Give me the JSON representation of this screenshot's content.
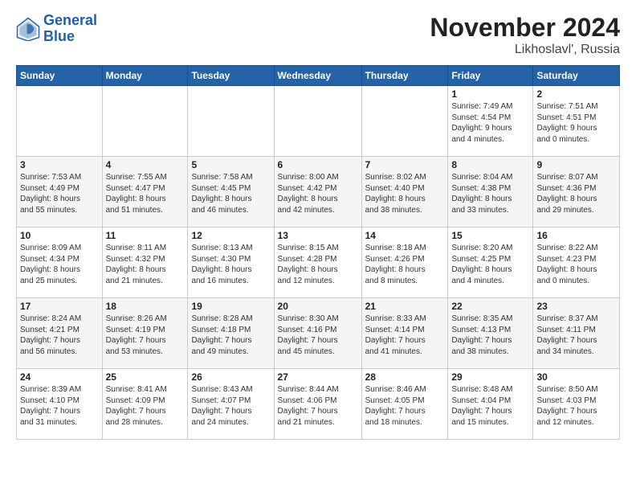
{
  "header": {
    "logo_line1": "General",
    "logo_line2": "Blue",
    "month": "November 2024",
    "location": "Likhoslavl', Russia"
  },
  "weekdays": [
    "Sunday",
    "Monday",
    "Tuesday",
    "Wednesday",
    "Thursday",
    "Friday",
    "Saturday"
  ],
  "rows": [
    [
      {
        "day": "",
        "info": ""
      },
      {
        "day": "",
        "info": ""
      },
      {
        "day": "",
        "info": ""
      },
      {
        "day": "",
        "info": ""
      },
      {
        "day": "",
        "info": ""
      },
      {
        "day": "1",
        "info": "Sunrise: 7:49 AM\nSunset: 4:54 PM\nDaylight: 9 hours\nand 4 minutes."
      },
      {
        "day": "2",
        "info": "Sunrise: 7:51 AM\nSunset: 4:51 PM\nDaylight: 9 hours\nand 0 minutes."
      }
    ],
    [
      {
        "day": "3",
        "info": "Sunrise: 7:53 AM\nSunset: 4:49 PM\nDaylight: 8 hours\nand 55 minutes."
      },
      {
        "day": "4",
        "info": "Sunrise: 7:55 AM\nSunset: 4:47 PM\nDaylight: 8 hours\nand 51 minutes."
      },
      {
        "day": "5",
        "info": "Sunrise: 7:58 AM\nSunset: 4:45 PM\nDaylight: 8 hours\nand 46 minutes."
      },
      {
        "day": "6",
        "info": "Sunrise: 8:00 AM\nSunset: 4:42 PM\nDaylight: 8 hours\nand 42 minutes."
      },
      {
        "day": "7",
        "info": "Sunrise: 8:02 AM\nSunset: 4:40 PM\nDaylight: 8 hours\nand 38 minutes."
      },
      {
        "day": "8",
        "info": "Sunrise: 8:04 AM\nSunset: 4:38 PM\nDaylight: 8 hours\nand 33 minutes."
      },
      {
        "day": "9",
        "info": "Sunrise: 8:07 AM\nSunset: 4:36 PM\nDaylight: 8 hours\nand 29 minutes."
      }
    ],
    [
      {
        "day": "10",
        "info": "Sunrise: 8:09 AM\nSunset: 4:34 PM\nDaylight: 8 hours\nand 25 minutes."
      },
      {
        "day": "11",
        "info": "Sunrise: 8:11 AM\nSunset: 4:32 PM\nDaylight: 8 hours\nand 21 minutes."
      },
      {
        "day": "12",
        "info": "Sunrise: 8:13 AM\nSunset: 4:30 PM\nDaylight: 8 hours\nand 16 minutes."
      },
      {
        "day": "13",
        "info": "Sunrise: 8:15 AM\nSunset: 4:28 PM\nDaylight: 8 hours\nand 12 minutes."
      },
      {
        "day": "14",
        "info": "Sunrise: 8:18 AM\nSunset: 4:26 PM\nDaylight: 8 hours\nand 8 minutes."
      },
      {
        "day": "15",
        "info": "Sunrise: 8:20 AM\nSunset: 4:25 PM\nDaylight: 8 hours\nand 4 minutes."
      },
      {
        "day": "16",
        "info": "Sunrise: 8:22 AM\nSunset: 4:23 PM\nDaylight: 8 hours\nand 0 minutes."
      }
    ],
    [
      {
        "day": "17",
        "info": "Sunrise: 8:24 AM\nSunset: 4:21 PM\nDaylight: 7 hours\nand 56 minutes."
      },
      {
        "day": "18",
        "info": "Sunrise: 8:26 AM\nSunset: 4:19 PM\nDaylight: 7 hours\nand 53 minutes."
      },
      {
        "day": "19",
        "info": "Sunrise: 8:28 AM\nSunset: 4:18 PM\nDaylight: 7 hours\nand 49 minutes."
      },
      {
        "day": "20",
        "info": "Sunrise: 8:30 AM\nSunset: 4:16 PM\nDaylight: 7 hours\nand 45 minutes."
      },
      {
        "day": "21",
        "info": "Sunrise: 8:33 AM\nSunset: 4:14 PM\nDaylight: 7 hours\nand 41 minutes."
      },
      {
        "day": "22",
        "info": "Sunrise: 8:35 AM\nSunset: 4:13 PM\nDaylight: 7 hours\nand 38 minutes."
      },
      {
        "day": "23",
        "info": "Sunrise: 8:37 AM\nSunset: 4:11 PM\nDaylight: 7 hours\nand 34 minutes."
      }
    ],
    [
      {
        "day": "24",
        "info": "Sunrise: 8:39 AM\nSunset: 4:10 PM\nDaylight: 7 hours\nand 31 minutes."
      },
      {
        "day": "25",
        "info": "Sunrise: 8:41 AM\nSunset: 4:09 PM\nDaylight: 7 hours\nand 28 minutes."
      },
      {
        "day": "26",
        "info": "Sunrise: 8:43 AM\nSunset: 4:07 PM\nDaylight: 7 hours\nand 24 minutes."
      },
      {
        "day": "27",
        "info": "Sunrise: 8:44 AM\nSunset: 4:06 PM\nDaylight: 7 hours\nand 21 minutes."
      },
      {
        "day": "28",
        "info": "Sunrise: 8:46 AM\nSunset: 4:05 PM\nDaylight: 7 hours\nand 18 minutes."
      },
      {
        "day": "29",
        "info": "Sunrise: 8:48 AM\nSunset: 4:04 PM\nDaylight: 7 hours\nand 15 minutes."
      },
      {
        "day": "30",
        "info": "Sunrise: 8:50 AM\nSunset: 4:03 PM\nDaylight: 7 hours\nand 12 minutes."
      }
    ]
  ]
}
